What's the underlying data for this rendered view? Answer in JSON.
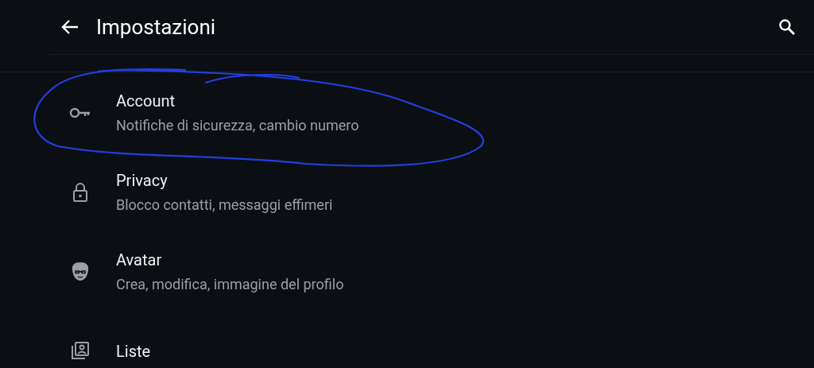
{
  "header": {
    "title": "Impostazioni"
  },
  "items": [
    {
      "kind": "key",
      "title": "Account",
      "subtitle": "Notifiche di sicurezza, cambio numero"
    },
    {
      "kind": "lock",
      "title": "Privacy",
      "subtitle": "Blocco contatti, messaggi effimeri"
    },
    {
      "kind": "avatar",
      "title": "Avatar",
      "subtitle": "Crea, modifica, immagine del profilo"
    },
    {
      "kind": "lists",
      "title": "Liste"
    }
  ]
}
